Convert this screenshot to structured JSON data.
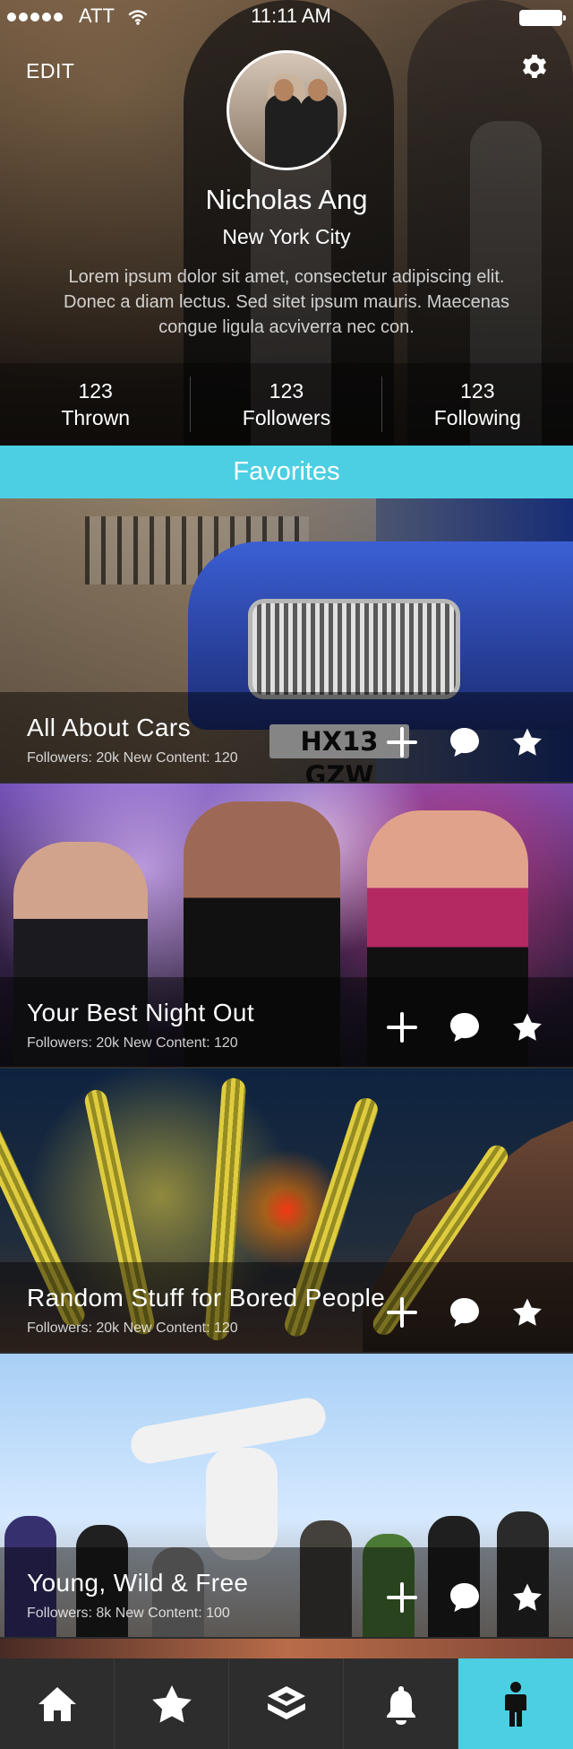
{
  "status_bar": {
    "carrier": "ATT",
    "time": "11:11 AM"
  },
  "header": {
    "edit_label": "EDIT",
    "settings_icon": "gear-icon"
  },
  "profile": {
    "name": "Nicholas Ang",
    "location": "New York City",
    "bio": "Lorem ipsum dolor sit amet, consectetur adipiscing elit. Donec a diam lectus. Sed sitet ipsum mauris. Maecenas congue ligula acviverra nec con.",
    "stats": [
      {
        "value": "123",
        "label": "Thrown"
      },
      {
        "value": "123",
        "label": "Followers"
      },
      {
        "value": "123",
        "label": "Following"
      }
    ]
  },
  "favorites": {
    "title": "Favorites",
    "cards": [
      {
        "title": "All About Cars",
        "meta": "Followers: 20k New Content: 120",
        "plate_text": "HX13 GZW"
      },
      {
        "title": "Your Best Night Out",
        "meta": "Followers: 20k New Content: 120"
      },
      {
        "title": "Random Stuff for Bored People",
        "meta": "Followers: 20k New Content: 120"
      },
      {
        "title": "Young, Wild & Free",
        "meta": "Followers: 8k New Content: 100"
      }
    ]
  },
  "tab_bar": {
    "tabs": [
      {
        "icon": "home-icon"
      },
      {
        "icon": "star-icon"
      },
      {
        "icon": "layers-icon"
      },
      {
        "icon": "bell-icon"
      },
      {
        "icon": "profile-icon"
      }
    ]
  },
  "colors": {
    "accent": "#4ccfe2",
    "tab_bar": "#2d2d2d",
    "text_light": "#ffffff"
  }
}
